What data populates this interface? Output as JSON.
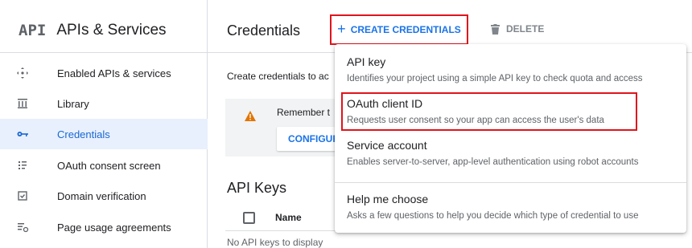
{
  "sidebar": {
    "logo": "API",
    "title": "APIs & Services",
    "items": [
      {
        "label": "Enabled APIs & services",
        "icon": "enabled-apis-icon"
      },
      {
        "label": "Library",
        "icon": "library-icon"
      },
      {
        "label": "Credentials",
        "icon": "key-icon",
        "active": true
      },
      {
        "label": "OAuth consent screen",
        "icon": "consent-icon"
      },
      {
        "label": "Domain verification",
        "icon": "domain-verification-icon"
      },
      {
        "label": "Page usage agreements",
        "icon": "settings-list-icon"
      }
    ]
  },
  "header": {
    "title": "Credentials",
    "create_label": "CREATE CREDENTIALS",
    "delete_label": "DELETE"
  },
  "main": {
    "intro_text": "Create credentials to ac",
    "notice_text": "Remember t",
    "configure_label": "CONFIGUR",
    "api_keys_title": "API Keys",
    "table_header_name": "Name",
    "empty_text": "No API keys to display"
  },
  "menu": {
    "items": [
      {
        "title": "API key",
        "desc": "Identifies your project using a simple API key to check quota and access"
      },
      {
        "title": "OAuth client ID",
        "desc": "Requests user consent so your app can access the user's data",
        "highlighted": true
      },
      {
        "title": "Service account",
        "desc": "Enables server-to-server, app-level authentication using robot accounts"
      },
      {
        "title": "Help me choose",
        "desc": "Asks a few questions to help you decide which type of credential to use"
      }
    ]
  },
  "colors": {
    "accent": "#1a73e8",
    "active_bg": "#e8f0fe",
    "highlight_border": "#e0141b",
    "warning": "#e37400"
  }
}
